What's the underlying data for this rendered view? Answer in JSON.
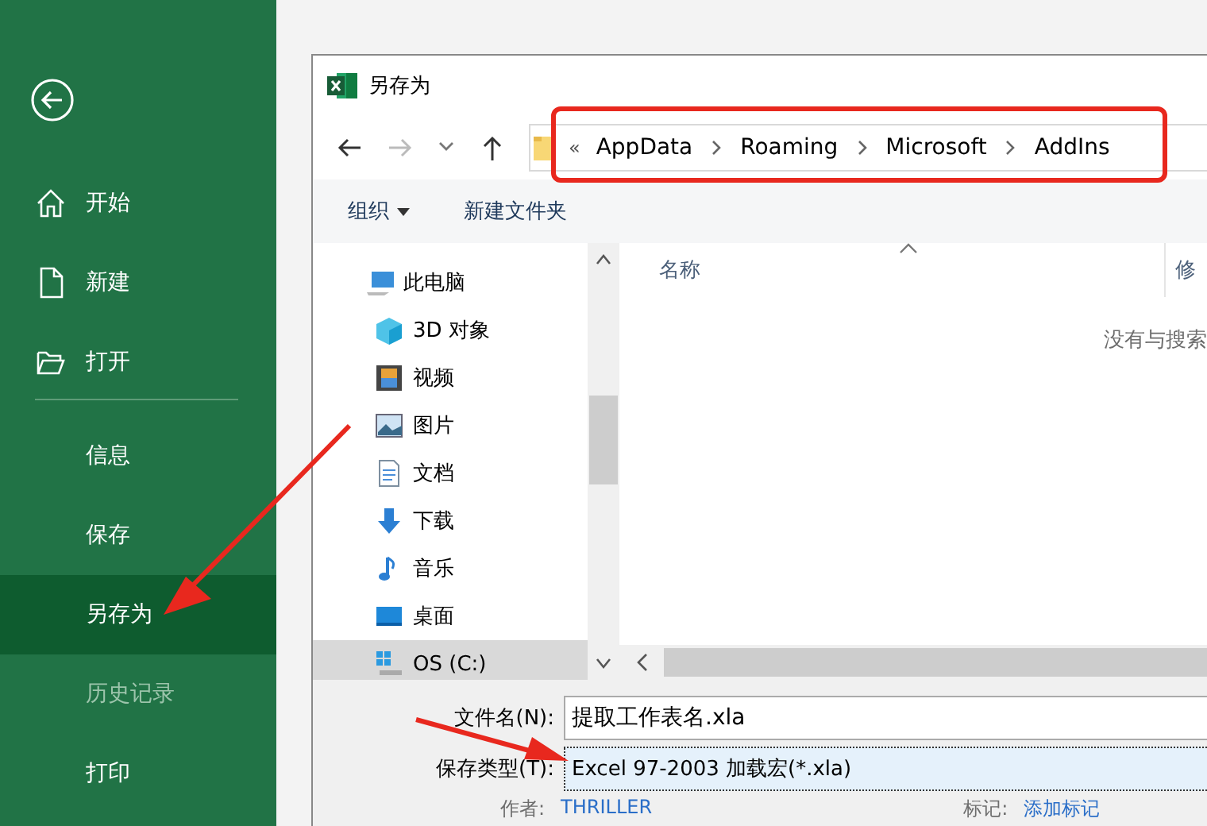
{
  "backstage": {
    "items": [
      {
        "label": "开始",
        "kind": "home",
        "selected": false,
        "disabled": false
      },
      {
        "label": "新建",
        "kind": "new",
        "selected": false,
        "disabled": false
      },
      {
        "label": "打开",
        "kind": "open",
        "selected": false,
        "disabled": false
      },
      {
        "kind": "divider"
      },
      {
        "label": "信息",
        "kind": "plain",
        "selected": false,
        "disabled": false
      },
      {
        "label": "保存",
        "kind": "plain",
        "selected": false,
        "disabled": false
      },
      {
        "label": "另存为",
        "kind": "plain",
        "selected": true,
        "disabled": false
      },
      {
        "label": "历史记录",
        "kind": "plain",
        "selected": false,
        "disabled": true
      },
      {
        "label": "打印",
        "kind": "plain",
        "selected": false,
        "disabled": false
      }
    ]
  },
  "dialog": {
    "title": "另存为",
    "address": {
      "overflow": "«",
      "segments": [
        "AppData",
        "Roaming",
        "Microsoft",
        "AddIns"
      ]
    },
    "toolbar": {
      "organize": "组织",
      "new_folder": "新建文件夹"
    },
    "tree": [
      {
        "label": "此电脑",
        "kind": "pc",
        "selected": false,
        "children": [
          {
            "label": "3D 对象",
            "kind": "cube",
            "selected": false
          },
          {
            "label": "视频",
            "kind": "video",
            "selected": false
          },
          {
            "label": "图片",
            "kind": "picture",
            "selected": false
          },
          {
            "label": "文档",
            "kind": "document",
            "selected": false
          },
          {
            "label": "下载",
            "kind": "download",
            "selected": false
          },
          {
            "label": "音乐",
            "kind": "music",
            "selected": false
          },
          {
            "label": "桌面",
            "kind": "desktop",
            "selected": false
          },
          {
            "label": "OS (C:)",
            "kind": "drive",
            "selected": true
          }
        ]
      }
    ],
    "file_list": {
      "columns": [
        "名称",
        "修"
      ],
      "empty_message": "没有与搜索"
    },
    "file_name": {
      "label": "文件名(N):",
      "value": "提取工作表名.xla"
    },
    "save_type": {
      "label": "保存类型(T):",
      "value": "Excel 97-2003 加载宏(*.xla)"
    },
    "meta": [
      {
        "label": "作者:",
        "value": "THRILLER"
      },
      {
        "label": "标记:",
        "value": "添加标记"
      }
    ]
  }
}
